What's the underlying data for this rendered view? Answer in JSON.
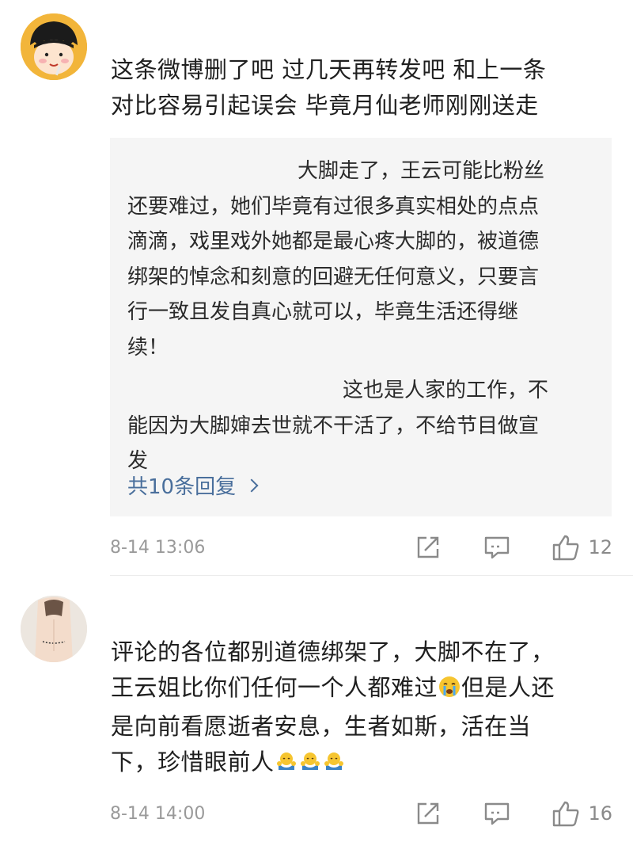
{
  "comments": [
    {
      "lines": [
        "这条微博删了吧  过几天再转发吧  和上一条",
        "对比容易引起误会 毕竟月仙老师刚刚送走"
      ],
      "quote": {
        "p1_lines": [
          "大脚走了，王云可能比粉丝",
          "还要难过，她们毕竟有过很多真实相处的点点",
          "滴滴，戏里戏外她都是最心疼大脚的，被道德",
          "绑架的悼念和刻意的回避无任何意义，只要言",
          "行一致且发自真心就可以，毕竟生活还得继",
          "续！"
        ],
        "p2_lines": [
          "这也是人家的工作，不",
          "能因为大脚婶去世就不干活了，不给节目做宣",
          "发"
        ],
        "replies_label": "共10条回复"
      },
      "time": "8-14 13:06",
      "like_count": "12"
    },
    {
      "lines": [
        "评论的各位都别道德绑架了，大脚不在了，",
        "王云姐比你们任何一个人都难过",
        "但是人还",
        "是向前看愿逝者安息，生者如斯，活在当",
        "下，珍惜眼前人"
      ],
      "time": "8-14 14:00",
      "like_count": "16"
    }
  ],
  "icons": {
    "share": "share-icon",
    "comment": "comment-icon",
    "like": "thumbs-up-icon",
    "crying": "crying-emoji-icon",
    "hug": "hug-emoji-icon"
  }
}
